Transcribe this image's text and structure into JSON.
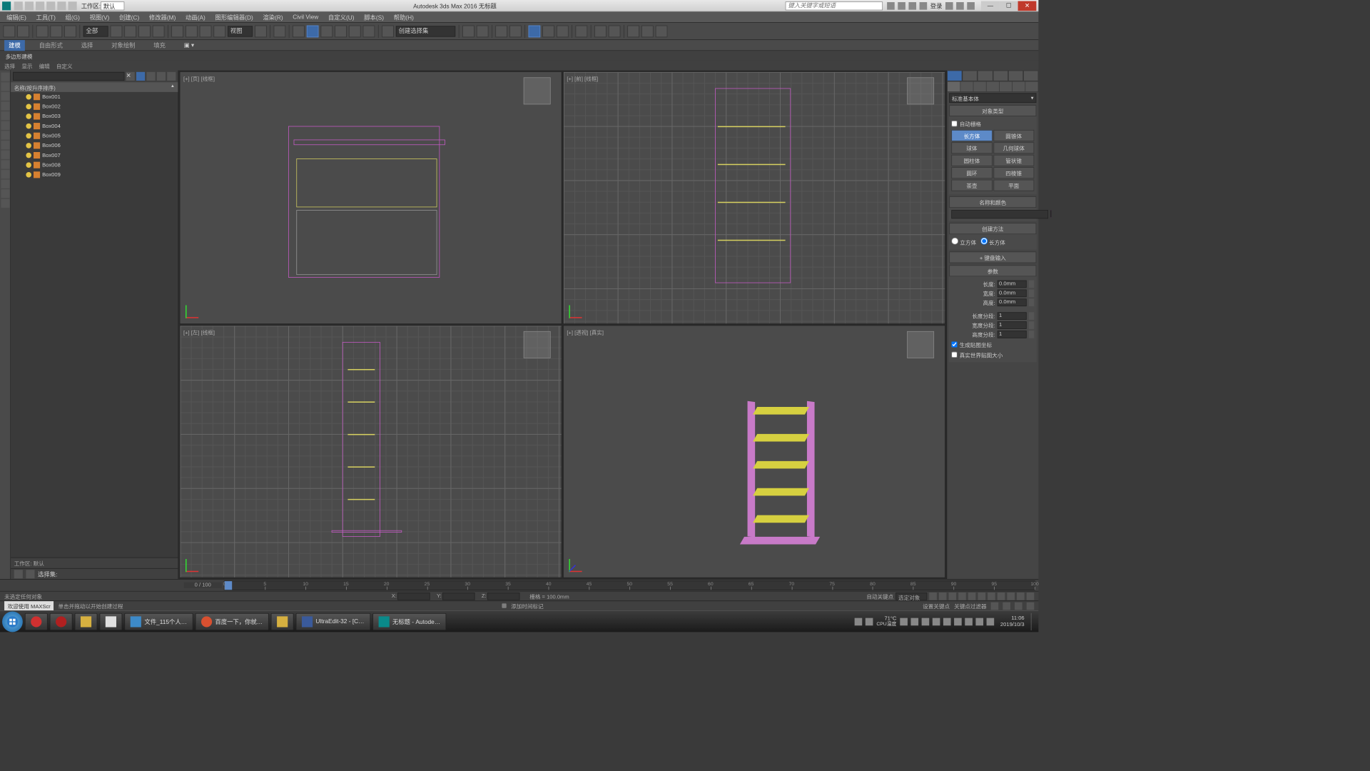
{
  "titlebar": {
    "workspace_label": "工作区: ",
    "workspace_value": "默认",
    "app_title": "Autodesk 3ds Max 2016   无标题",
    "search_placeholder": "键入关键字或短语",
    "signin": "登录"
  },
  "menu": [
    "编辑(E)",
    "工具(T)",
    "组(G)",
    "视图(V)",
    "创建(C)",
    "修改器(M)",
    "动画(A)",
    "图形编辑器(D)",
    "渲染(R)",
    "Civil View",
    "自定义(U)",
    "脚本(S)",
    "帮助(H)"
  ],
  "toolbar": {
    "dd_all": "全部",
    "dd_view": "视图",
    "dd_createset": "创建选择集"
  },
  "ribbon": {
    "tabs": [
      "建模",
      "自由形式",
      "选择",
      "对象绘制",
      "填充"
    ],
    "active": 0,
    "sub": "多边形建模"
  },
  "ribbon2": [
    "选择",
    "显示",
    "编辑",
    "自定义"
  ],
  "scene": {
    "header": "名称(按升序排序)",
    "items": [
      "Box001",
      "Box002",
      "Box003",
      "Box004",
      "Box005",
      "Box006",
      "Box007",
      "Box008",
      "Box009"
    ],
    "workspace": "工作区: 默认",
    "selset": "选择集:"
  },
  "viewports": {
    "top": "[+] [页] [线框]",
    "front": "[+] [前] [线框]",
    "left": "[+] [左] [线框]",
    "persp": "[+] [透视] [真实]"
  },
  "cmd": {
    "dd": "标准基本体",
    "objtype": "对象类型",
    "autogrid": "自动栅格",
    "btns": [
      [
        "长方体",
        "圆锥体"
      ],
      [
        "球体",
        "几何球体"
      ],
      [
        "圆柱体",
        "管状锥"
      ],
      [
        "圆环",
        "四棱锥"
      ],
      [
        "茶壶",
        "平面"
      ]
    ],
    "namecolor": "名称和颜色",
    "createmethod": "创建方法",
    "radio_cube": "立方体",
    "radio_box": "长方体",
    "kbdentry": "键盘输入",
    "params": "参数",
    "len": "长度:",
    "wid": "宽度:",
    "hei": "高度:",
    "lenseg": "长度分段:",
    "widseg": "宽度分段:",
    "heiseg": "高度分段:",
    "val0": "0.0mm",
    "val1": "1",
    "gen_uv": "生成贴图坐标",
    "real_uv": "真实世界贴图大小"
  },
  "timeline": {
    "frame": "0 / 100",
    "ticks": [
      0,
      5,
      10,
      15,
      20,
      25,
      30,
      35,
      40,
      45,
      50,
      55,
      60,
      65,
      70,
      75,
      80,
      85,
      90,
      95,
      100
    ]
  },
  "status": {
    "nosel": "未选定任何对象",
    "hint": "单击并拖动以开始创建过程",
    "welcome": "欢迎使用 MAXScr",
    "x": "X:",
    "y": "Y:",
    "z": "Z:",
    "grid": "栅格 = 100.0mm",
    "addtime": "添加时间标记",
    "autokey": "自动关键点",
    "selobj": "选定对象",
    "setkey": "设置关键点",
    "keyfilter": "关键点过滤器"
  },
  "taskbar": {
    "items": [
      {
        "label": "文件_115个人…",
        "color": "#3d8ac8"
      },
      {
        "label": "百度一下，你就…",
        "color": "#d85030"
      },
      {
        "label": "",
        "color": "#d6b040"
      },
      {
        "label": "UltraEdit-32 - [C…",
        "color": "#3a5a9a"
      },
      {
        "label": "无标题 - Autode…",
        "color": "#0a8a8a"
      }
    ],
    "temp": "71°C",
    "cpu": "CPU温度",
    "time": "11:06",
    "date": "2019/10/3"
  }
}
